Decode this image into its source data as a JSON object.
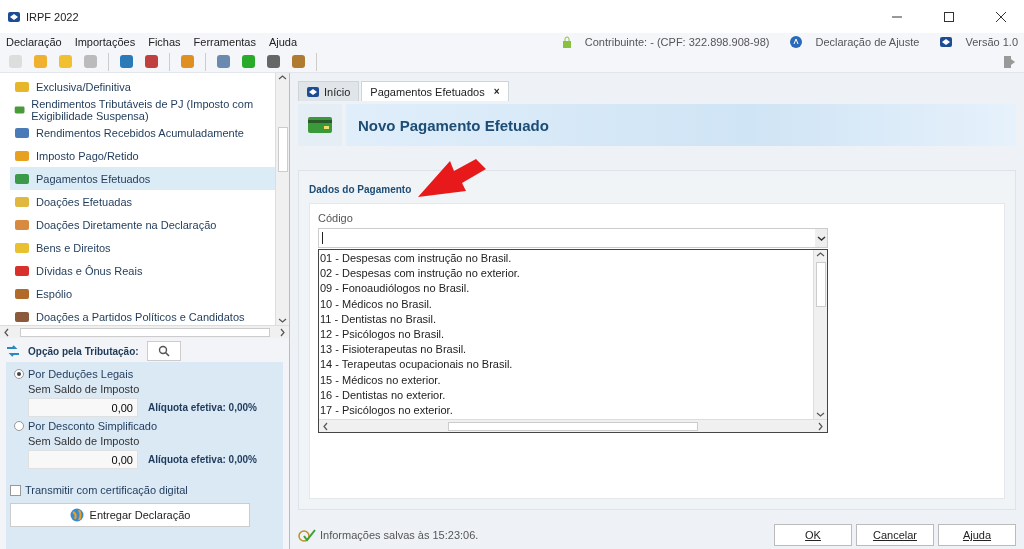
{
  "window": {
    "title": "IRPF 2022"
  },
  "menu": [
    "Declaração",
    "Importações",
    "Fichas",
    "Ferramentas",
    "Ajuda"
  ],
  "info": {
    "contribuinte": "Contribuinte:  - (CPF: 322.898.908-98)",
    "declaracao": "Declaração de Ajuste",
    "versao": "Versão 1.0"
  },
  "sidebar": {
    "items": [
      {
        "label": "Exclusiva/Definitiva",
        "selected": false
      },
      {
        "label": "Rendimentos Tributáveis de PJ (Imposto com Exigibilidade Suspensa)",
        "selected": false
      },
      {
        "label": "Rendimentos Recebidos Acumuladamente",
        "selected": false
      },
      {
        "label": "Imposto Pago/Retido",
        "selected": false
      },
      {
        "label": "Pagamentos Efetuados",
        "selected": true
      },
      {
        "label": "Doações Efetuadas",
        "selected": false
      },
      {
        "label": "Doações Diretamente na Declaração",
        "selected": false
      },
      {
        "label": "Bens e Direitos",
        "selected": false
      },
      {
        "label": "Dívidas e Ônus Reais",
        "selected": false
      },
      {
        "label": "Espólio",
        "selected": false
      },
      {
        "label": "Doações a Partidos Políticos e Candidatos",
        "selected": false
      }
    ]
  },
  "tributacao": {
    "title": "Opção pela Tributação:",
    "options": [
      {
        "label": "Por Deduções Legais",
        "selected": true,
        "saldo": "Sem Saldo de Imposto",
        "value": "0,00",
        "aliquota": "Alíquota efetiva: 0,00%"
      },
      {
        "label": "Por Desconto Simplificado",
        "selected": false,
        "saldo": "Sem Saldo de Imposto",
        "value": "0,00",
        "aliquota": "Alíquota efetiva: 0,00%"
      }
    ],
    "certificacao": {
      "label": "Transmitir com certificação digital",
      "checked": false
    },
    "submit": "Entregar Declaração"
  },
  "tabs": [
    {
      "label": "Início",
      "selected": false
    },
    {
      "label": "Pagamentos Efetuados",
      "selected": true,
      "close": "×"
    }
  ],
  "header": {
    "title": "Novo Pagamento Efetuado"
  },
  "section": {
    "title": "Dados do Pagamento",
    "field_label": "Código",
    "options": [
      "01 - Despesas com instrução no Brasil.",
      "02 - Despesas com instrução no exterior.",
      "09 - Fonoaudiólogos no Brasil.",
      "10 - Médicos no Brasil.",
      "11 - Dentistas no Brasil.",
      "12 - Psicólogos no Brasil.",
      "13 - Fisioterapeutas no Brasil.",
      "14 - Terapeutas ocupacionais no Brasil.",
      "15 - Médicos no exterior.",
      "16 - Dentistas no exterior.",
      "17 - Psicólogos no exterior."
    ]
  },
  "status": {
    "text": "Informações salvas às 15:23:06."
  },
  "buttons": [
    "OK",
    "Cancelar",
    "Ajuda"
  ]
}
